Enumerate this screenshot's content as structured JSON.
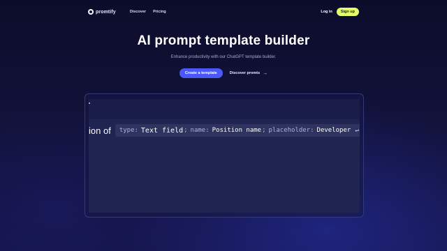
{
  "nav": {
    "brand": "promtify",
    "links": [
      "Discover",
      "Pricing"
    ],
    "login": "Log in",
    "signup": "Sign up"
  },
  "hero": {
    "title": "AI prompt template builder",
    "subtitle": "Enhance productivity with our ChatGPT template builder.",
    "primary_cta": "Create a template",
    "secondary_cta": "Discover promts"
  },
  "editor": {
    "prompt_text": "ion of",
    "field": {
      "type_key": "type:",
      "type_value": "Text field",
      "name_key": "name:",
      "name_value": "Position name",
      "placeholder_key": "placeholder:",
      "placeholder_value": "Developer",
      "separator": ";"
    }
  },
  "icons": {
    "logo": "promtify-logo-icon",
    "arrow": "arrow-right-icon",
    "return": "return-icon"
  },
  "colors": {
    "accent": "#4a58f7",
    "signup": "#e4fd6a",
    "background": "#12123a"
  }
}
